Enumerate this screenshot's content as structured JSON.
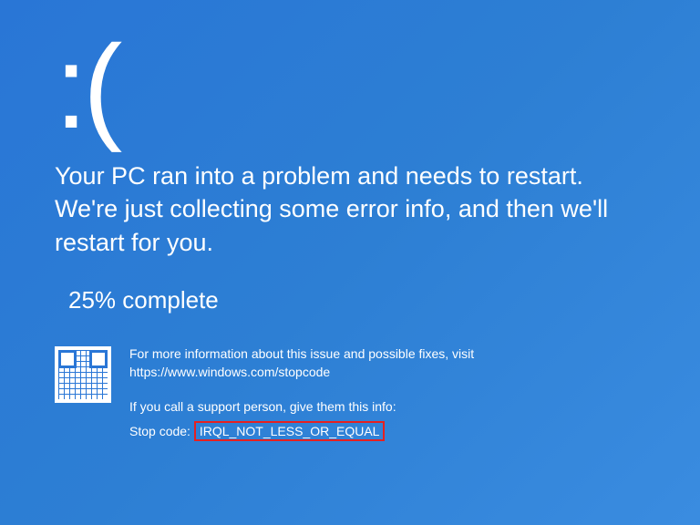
{
  "sad_face": ":(",
  "main_message": "Your PC ran into a problem and needs to restart. We're just collecting some error info, and then we'll restart for you.",
  "progress": "25% complete",
  "help": {
    "more_info": "For more information about this issue and possible fixes, visit",
    "url": "https://www.windows.com/stopcode",
    "support_info": "If you call a support person, give them this info:",
    "stop_code_label": "Stop code:",
    "stop_code_value": "IRQL_NOT_LESS_OR_EQUAL"
  }
}
